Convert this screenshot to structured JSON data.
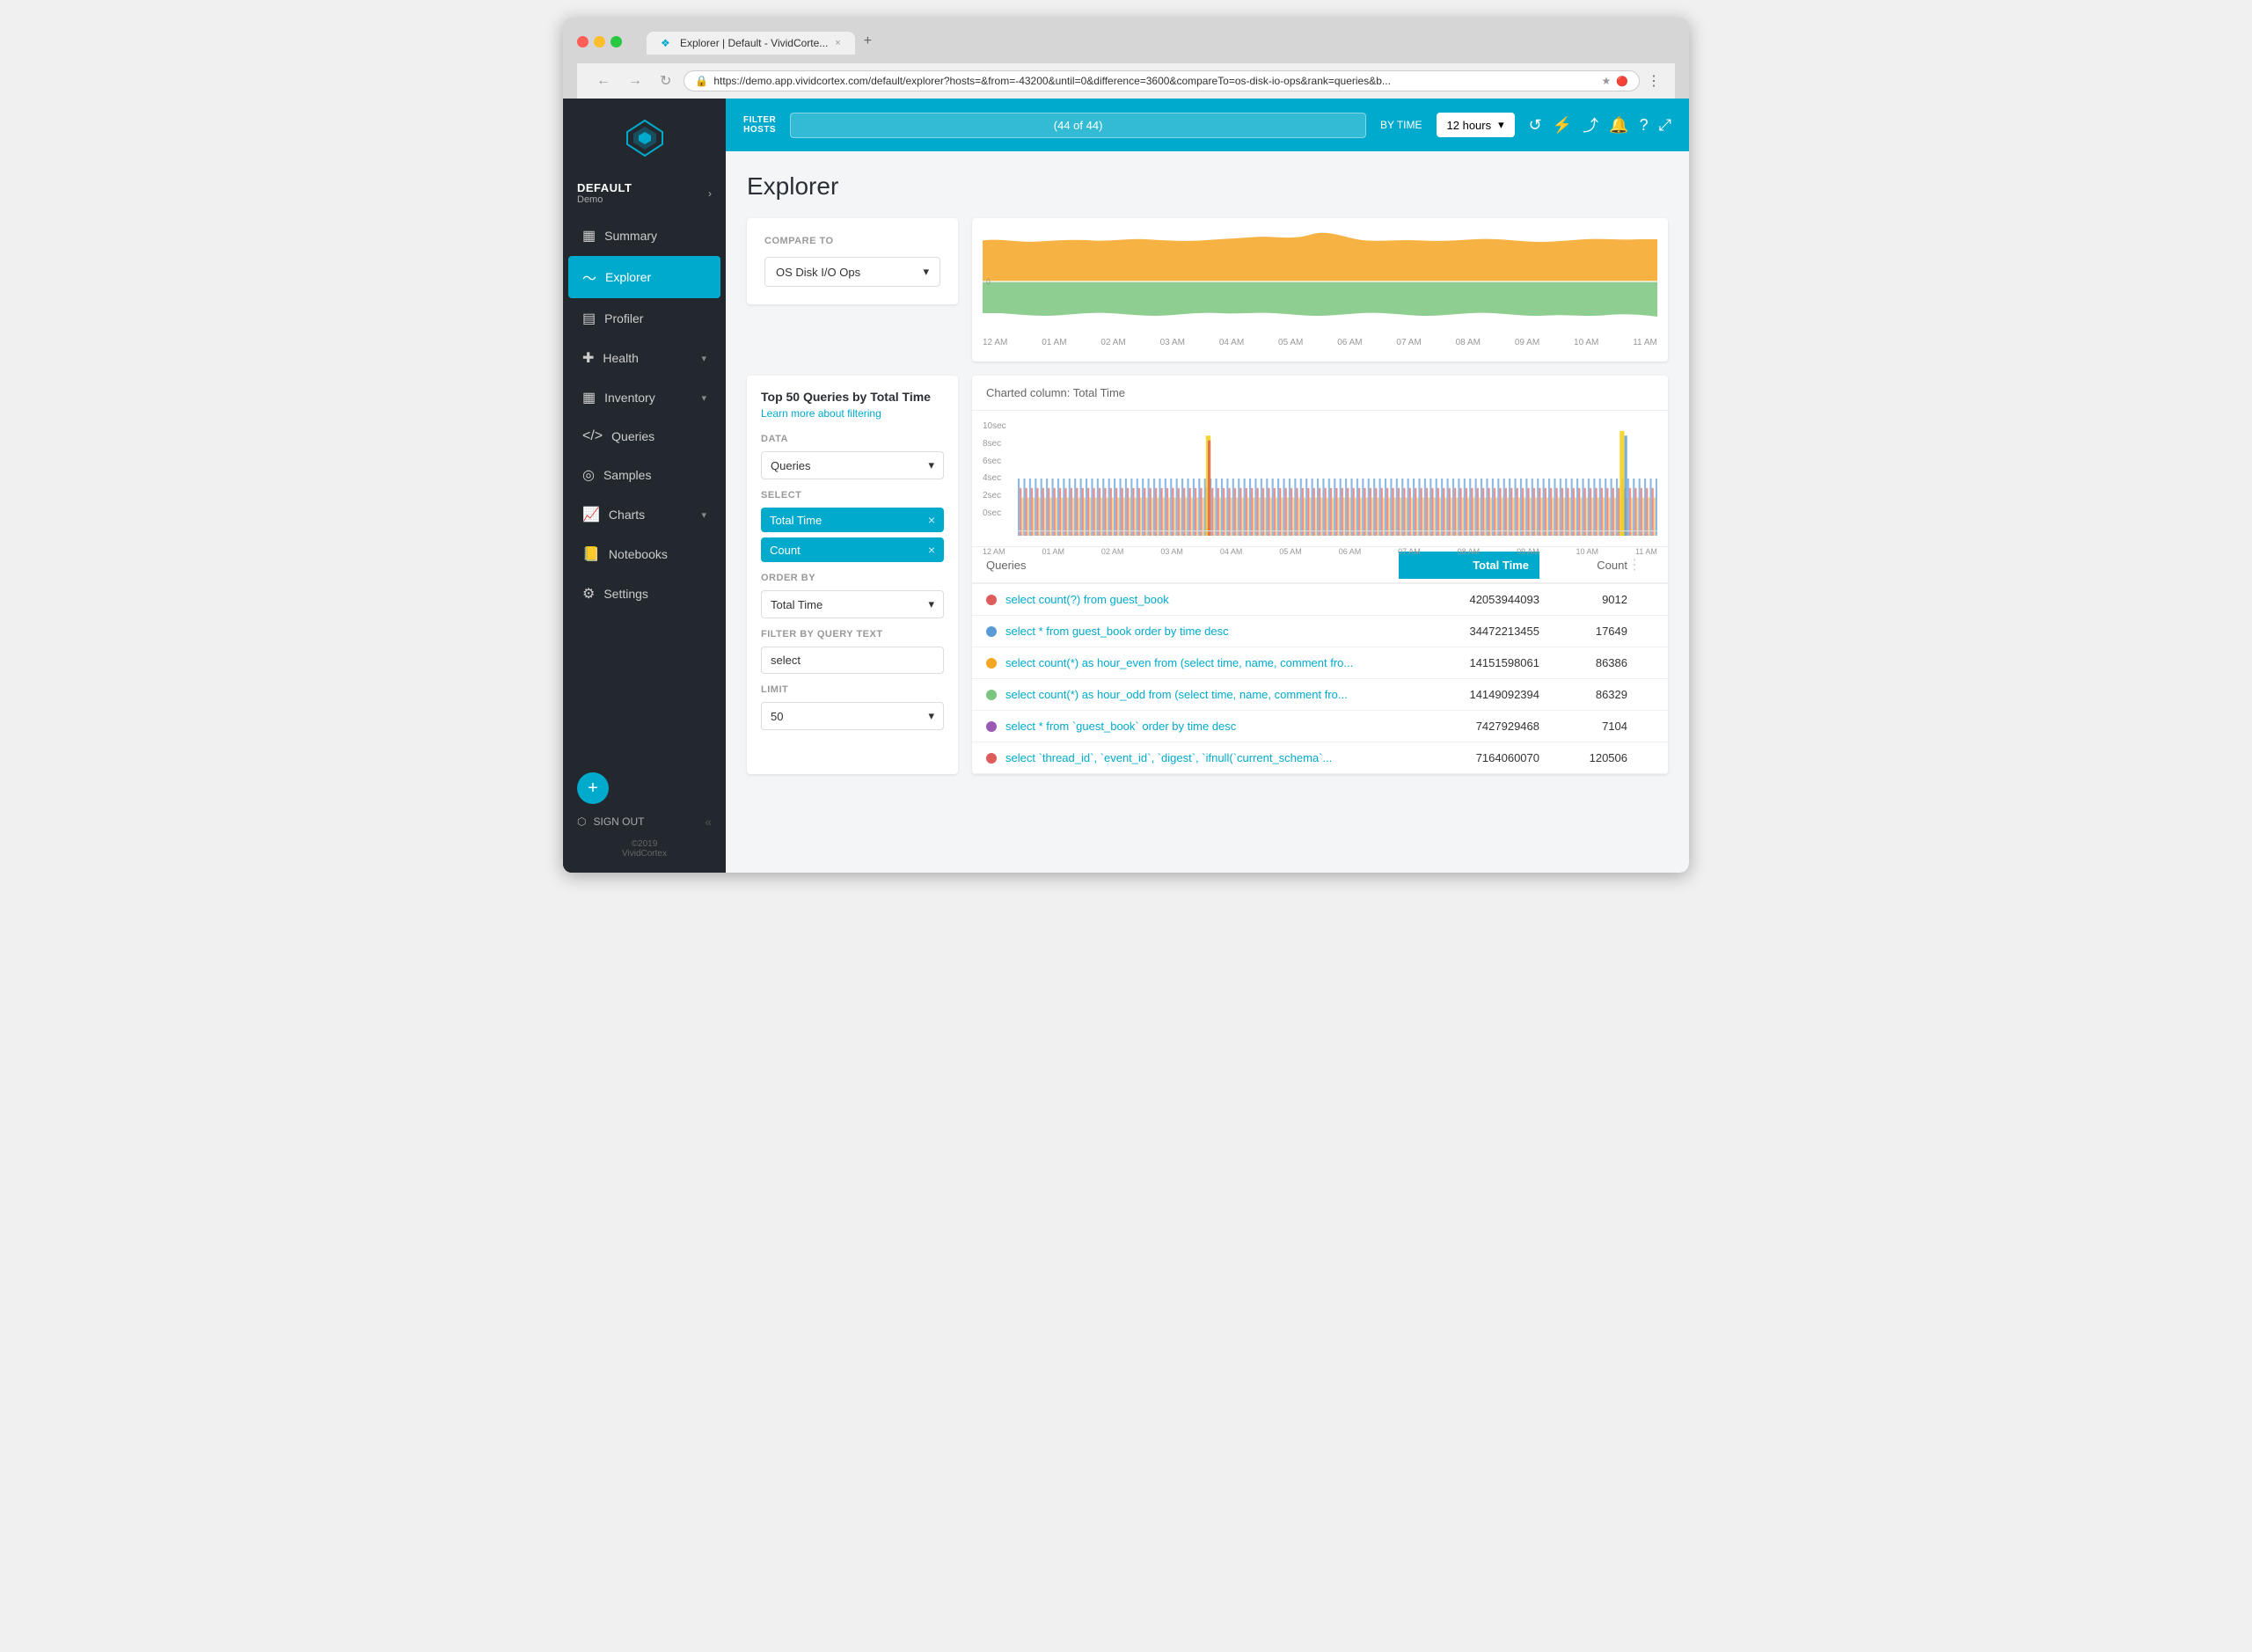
{
  "browser": {
    "tab_title": "Explorer | Default - VividCorte...",
    "tab_close": "×",
    "new_tab": "+",
    "url": "https://demo.app.vividcortex.com/default/explorer?hosts=&from=-43200&until=0&difference=3600&compareTo=os-disk-io-ops&rank=queries&b...",
    "nav_back": "←",
    "nav_forward": "→",
    "nav_reload": "↻"
  },
  "topbar": {
    "filter_label": "FILTER\nHOSTS",
    "filter_placeholder": "(44 of 44)",
    "by_time_label": "BY TIME",
    "time_value": "12 hours",
    "time_chevron": "▾"
  },
  "topbar_icons": {
    "refresh": "↺",
    "bolt": "⚡",
    "share": "⤴",
    "bell": "🔔",
    "help": "?",
    "expand": "⤢"
  },
  "sidebar": {
    "default_label": "DEFAULT",
    "demo_label": "Demo",
    "arrow": "›",
    "items": [
      {
        "id": "summary",
        "label": "Summary",
        "icon": "▦",
        "active": false,
        "has_chevron": false
      },
      {
        "id": "explorer",
        "label": "Explorer",
        "icon": "〜",
        "active": true,
        "has_chevron": false
      },
      {
        "id": "profiler",
        "label": "Profiler",
        "icon": "▤",
        "active": false,
        "has_chevron": false
      },
      {
        "id": "health",
        "label": "Health",
        "icon": "✚",
        "active": false,
        "has_chevron": true
      },
      {
        "id": "inventory",
        "label": "Inventory",
        "icon": "▦",
        "active": false,
        "has_chevron": true
      },
      {
        "id": "queries",
        "label": "Queries",
        "icon": "⟨⟩",
        "active": false,
        "has_chevron": false
      },
      {
        "id": "samples",
        "label": "Samples",
        "icon": "◎",
        "active": false,
        "has_chevron": false
      },
      {
        "id": "charts",
        "label": "Charts",
        "icon": "📈",
        "active": false,
        "has_chevron": true
      },
      {
        "id": "notebooks",
        "label": "Notebooks",
        "icon": "📒",
        "active": false,
        "has_chevron": false
      },
      {
        "id": "settings",
        "label": "Settings",
        "icon": "⚙",
        "active": false,
        "has_chevron": false
      }
    ],
    "add_btn": "+",
    "sign_out": "SIGN OUT",
    "copyright_year": "©2019",
    "copyright_name": "VividCortex"
  },
  "page": {
    "title": "Explorer"
  },
  "compare_section": {
    "label": "COMPARE TO",
    "selected_value": "OS Disk I/O Ops",
    "chevron": "▾"
  },
  "top_chart": {
    "xaxis_labels": [
      "12 AM",
      "01 AM",
      "02 AM",
      "03 AM",
      "04 AM",
      "05 AM",
      "06 AM",
      "07 AM",
      "08 AM",
      "09 AM",
      "10 AM",
      "11 AM"
    ],
    "zero_label": "0"
  },
  "query_panel": {
    "title": "Top 50 Queries by Total Time",
    "learn_more": "Learn more about filtering",
    "data_label": "DATA",
    "data_selected": "Queries",
    "data_chevron": "▾",
    "select_label": "SELECT",
    "tags": [
      {
        "id": "total-time",
        "label": "Total Time"
      },
      {
        "id": "count",
        "label": "Count"
      }
    ],
    "order_by_label": "ORDER BY",
    "order_by_selected": "Total Time",
    "order_by_chevron": "▾",
    "filter_label": "FILTER BY QUERY TEXT",
    "filter_value": "select",
    "limit_label": "LIMIT",
    "limit_value": "50",
    "limit_chevron": "▾"
  },
  "results_panel": {
    "charted_label": "Charted column: Total Time",
    "chart_yaxis": [
      "10sec",
      "8sec",
      "6sec",
      "4sec",
      "2sec",
      "0sec"
    ],
    "xaxis_labels": [
      "12 AM",
      "01 AM",
      "02 AM",
      "03 AM",
      "04 AM",
      "05 AM",
      "06 AM",
      "07 AM",
      "08 AM",
      "09 AM",
      "10 AM",
      "11 AM"
    ],
    "col_queries": "Queries",
    "col_total_time": "Total Time",
    "col_count": "Count",
    "rows": [
      {
        "dot_color": "#e05c5c",
        "query": "select count(?) from guest_book",
        "total_time": "42053944093",
        "count": "9012"
      },
      {
        "dot_color": "#5b9bd5",
        "query": "select * from guest_book order by time desc",
        "total_time": "34472213455",
        "count": "17649"
      },
      {
        "dot_color": "#f5a623",
        "query": "select count(*) as hour_even from (select time, name, comment fro...",
        "total_time": "14151598061",
        "count": "86386"
      },
      {
        "dot_color": "#7bc67e",
        "query": "select count(*) as hour_odd from (select time, name, comment fro...",
        "total_time": "14149092394",
        "count": "86329"
      },
      {
        "dot_color": "#9b59b6",
        "query": "select * from `guest_book` order by time desc",
        "total_time": "7427929468",
        "count": "7104"
      },
      {
        "dot_color": "#e05c5c",
        "query": "select `thread_id`, `event_id`, `digest`, `ifnull(`current_schema`...",
        "total_time": "7164060070",
        "count": "120506"
      }
    ]
  }
}
